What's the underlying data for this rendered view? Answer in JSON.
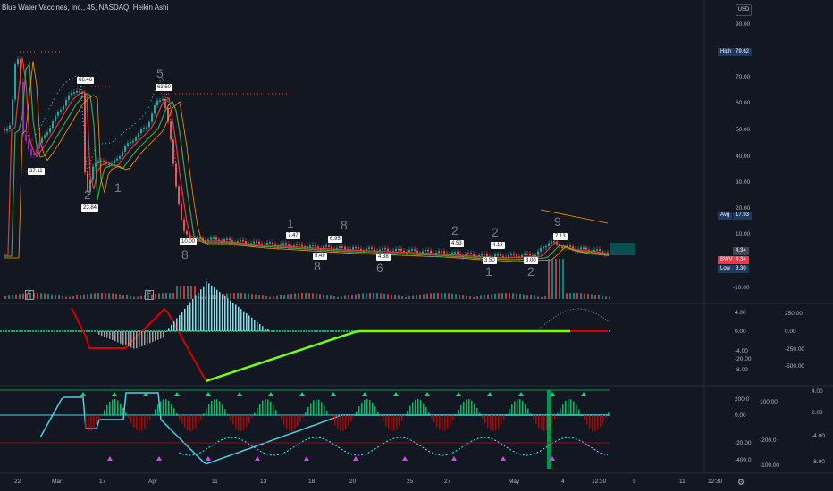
{
  "header": {
    "title": "Blue Water Vaccines, Inc., 45, NASDAQ, Heikin Ashi",
    "currency": "USD"
  },
  "price_axis": [
    "90.00",
    "80.00",
    "70.00",
    "60.00",
    "50.00",
    "40.00",
    "30.00",
    "20.00",
    "10.00",
    "-10.00"
  ],
  "badges": {
    "high_label": "High",
    "high_value": "79.62",
    "avg_label": "Avg",
    "avg_value": "17.93",
    "last_value": "4.34",
    "ticker": "BWV",
    "low_label": "Low",
    "low_value": "3.30"
  },
  "price_boxes": [
    "27.11",
    "66.46",
    "23.84",
    "63.50",
    "10.00",
    "7.47",
    "5.49",
    "6.95",
    "4.38",
    "4.53",
    "3.50",
    "4.18",
    "3.00",
    "7.13"
  ],
  "big_numbers": [
    "5",
    "2",
    "1",
    "8",
    "1",
    "8",
    "8",
    "6",
    "2",
    "1",
    "2",
    "2",
    "9"
  ],
  "earnings_markers": [
    "E",
    "E"
  ],
  "pane2_axis_left": [
    "4.00",
    "0.00",
    "-4.00",
    "-20.00",
    "-8.00"
  ],
  "pane2_axis_right": [
    "250.00",
    "0.00",
    "-250.00",
    "-500.00"
  ],
  "pane3_axis_left": [
    "200.0",
    "0.00",
    "-200.0",
    "-400.0"
  ],
  "pane3_axis_mid": [
    "100.00",
    "0.00",
    "-20.00",
    "-100.00"
  ],
  "pane3_axis_right": [
    "4.00",
    "2.00",
    "-4.00",
    "-8.00"
  ],
  "pane3_signals": [
    "60",
    "60",
    "60",
    "60",
    "60",
    "60",
    "60",
    "60",
    "60"
  ],
  "time_axis": [
    "22",
    "Mar",
    "17",
    "Apr",
    "11",
    "13",
    "18",
    "20",
    "25",
    "27",
    "May",
    "4",
    "12:30",
    "9",
    "11",
    "12:30"
  ],
  "settings_icon": "gear-icon",
  "colors": {
    "up": "#26a69a",
    "down": "#ef5350",
    "bg": "#131722",
    "green": "#00e676",
    "red": "#ff1744",
    "cyan": "#4dd0e1"
  }
}
